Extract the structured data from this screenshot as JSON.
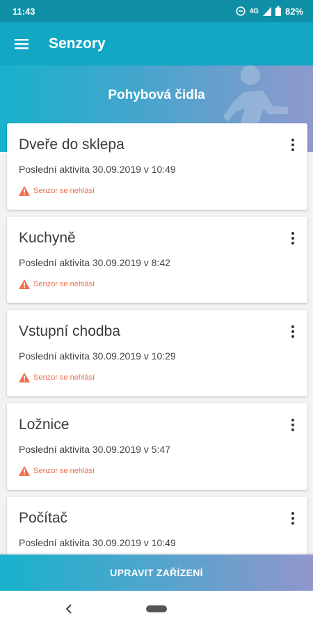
{
  "status_bar": {
    "time": "11:43",
    "network": "4G",
    "battery": "82%"
  },
  "app_bar": {
    "title": "Senzory"
  },
  "banner": {
    "title": "Pohybová čidla"
  },
  "sensors": [
    {
      "name": "Dveře do sklepa",
      "activity": "Poslední aktivita 30.09.2019 v 10:49",
      "warning": "Senzor se nehlásí"
    },
    {
      "name": "Kuchyně",
      "activity": "Poslední aktivita 30.09.2019 v 8:42",
      "warning": "Senzor se nehlásí"
    },
    {
      "name": "Vstupní chodba",
      "activity": "Poslední aktivita 30.09.2019 v 10:29",
      "warning": "Senzor se nehlásí"
    },
    {
      "name": "Ložnice",
      "activity": "Poslední aktivita 30.09.2019 v 5:47",
      "warning": "Senzor se nehlásí"
    },
    {
      "name": "Počítač",
      "activity": "Poslední aktivita 30.09.2019 v 10:49",
      "warning": ""
    }
  ],
  "bottom_button": {
    "label": "UPRAVIT ZAŘÍZENÍ"
  },
  "colors": {
    "primary": "#12a7c4",
    "status_bar": "#0e8fa6",
    "warning": "#f26b4a",
    "gradient_end": "#9196cc"
  },
  "icons": {
    "menu": "hamburger-icon",
    "more": "more-vert-icon",
    "warning": "warning-triangle-icon",
    "back": "back-icon",
    "home": "home-pill-icon",
    "dnd": "do-not-disturb-icon",
    "signal": "signal-icon",
    "battery": "battery-icon"
  }
}
